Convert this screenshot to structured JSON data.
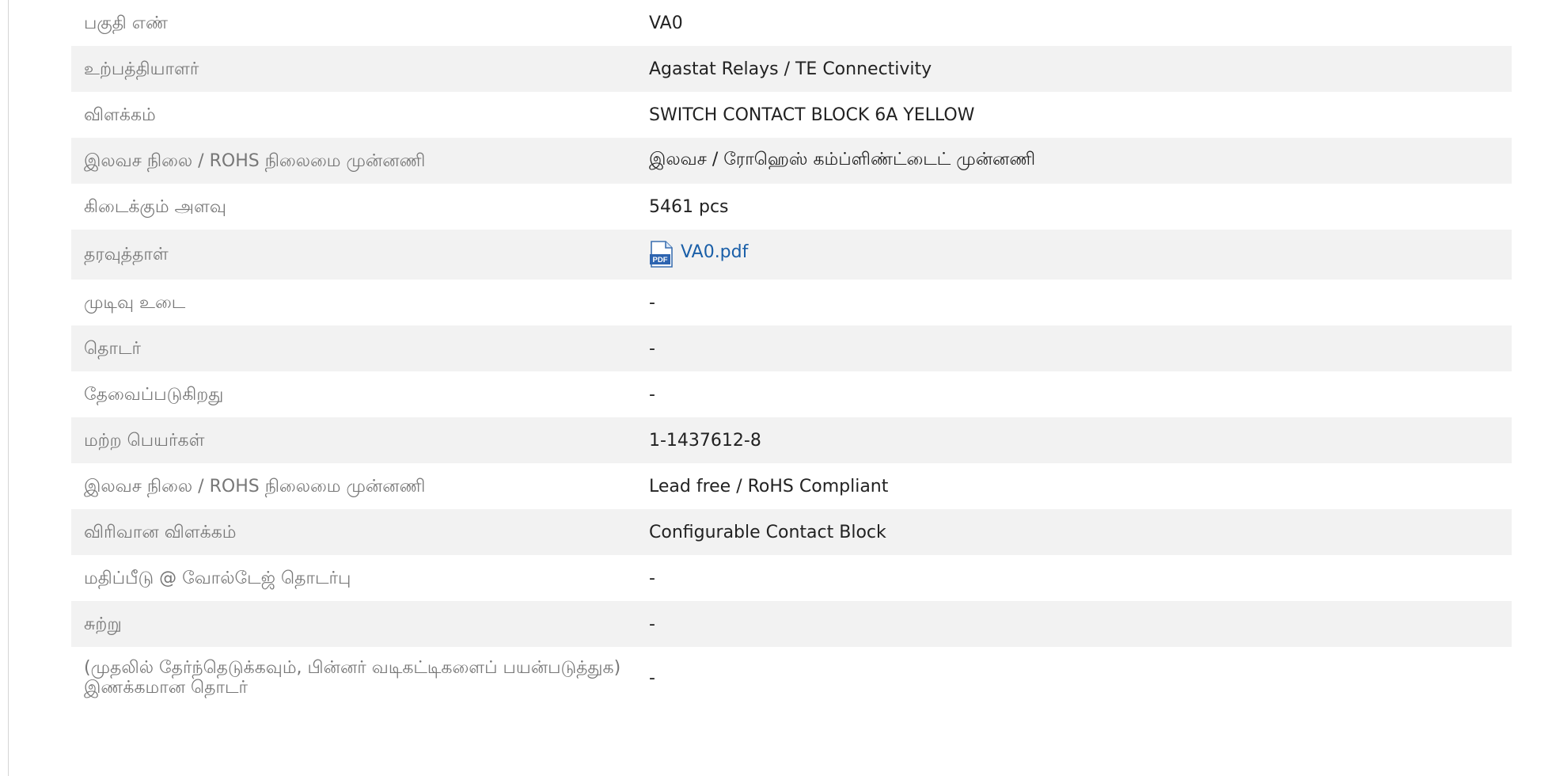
{
  "rows": [
    {
      "label": "பகுதி எண்",
      "value": "VA0"
    },
    {
      "label": "உற்பத்தியாளர்",
      "value": "Agastat Relays / TE Connectivity"
    },
    {
      "label": "விளக்கம்",
      "value": "SWITCH CONTACT BLOCK 6A YELLOW"
    },
    {
      "label": "இலவச நிலை / ROHS நிலைமை முன்னணி",
      "value": "இலவச / ரோஹெஸ் கம்ப்ளிண்ட்டைட் முன்னணி"
    },
    {
      "label": "கிடைக்கும் அளவு",
      "value": "5461 pcs"
    },
    {
      "label": "தரவுத்தாள்",
      "value": "VA0.pdf",
      "icon": "pdf-icon",
      "link_color": "#1a5fa8"
    },
    {
      "label": "முடிவு உடை",
      "value": "-"
    },
    {
      "label": "தொடர்",
      "value": "-"
    },
    {
      "label": "தேவைப்படுகிறது",
      "value": "-"
    },
    {
      "label": "மற்ற பெயர்கள்",
      "value": "1-1437612-8"
    },
    {
      "label": "இலவச நிலை / ROHS நிலைமை முன்னணி",
      "value": "Lead free / RoHS Compliant"
    },
    {
      "label": "விரிவான விளக்கம்",
      "value": "Configurable Contact Block"
    },
    {
      "label": "மதிப்பீடு @ வோல்டேஜ் தொடர்பு",
      "value": "-"
    },
    {
      "label": "சுற்று",
      "value": "-"
    },
    {
      "label": "(முதலில் தேர்ந்தெடுக்கவும், பின்னர் வடிகட்டிகளைப் பயன்படுத்துக) இணக்கமான தொடர்",
      "value": "-"
    }
  ]
}
